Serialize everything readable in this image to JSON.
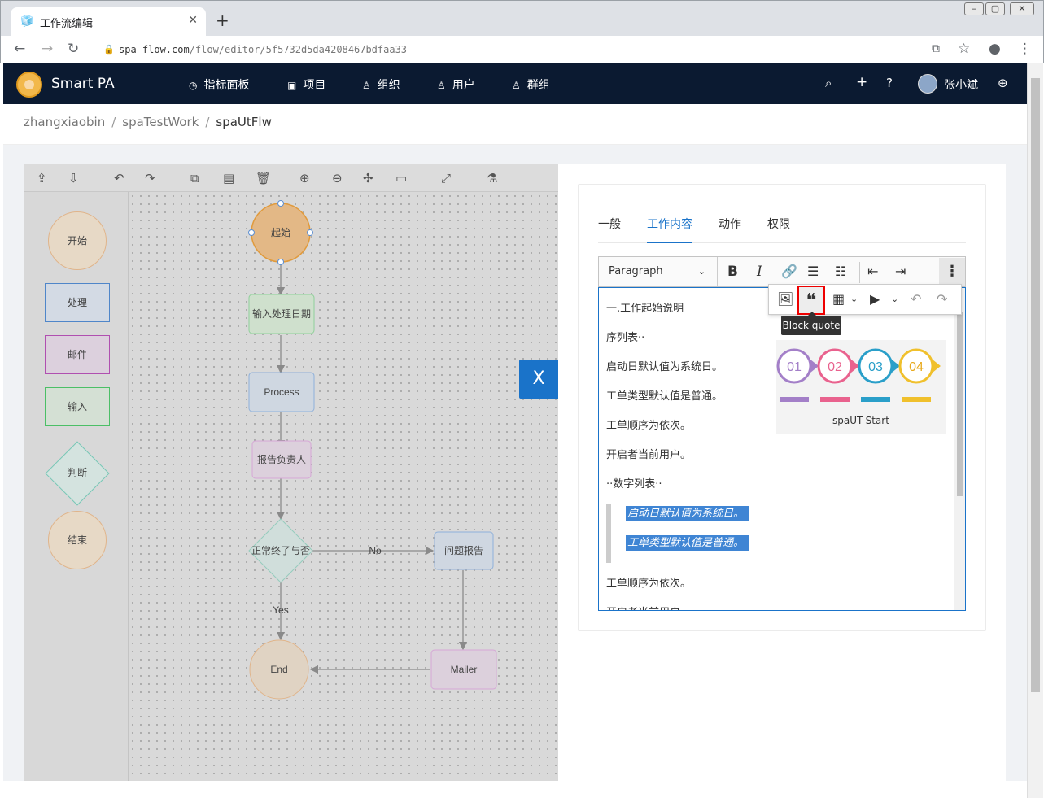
{
  "browser": {
    "tab_title": "工作流编辑",
    "tab_close": "✕",
    "new_tab": "+",
    "url_host": "spa-flow.com",
    "url_path": "/flow/editor/5f5732d5da4208467bdfaa33"
  },
  "app": {
    "name": "Smart PA",
    "nav": [
      {
        "label": "指标面板",
        "icon": "dashboard-icon"
      },
      {
        "label": "项目",
        "icon": "project-icon"
      },
      {
        "label": "组织",
        "icon": "org-icon"
      },
      {
        "label": "用户",
        "icon": "user-icon"
      },
      {
        "label": "群组",
        "icon": "group-icon"
      }
    ],
    "username": "张小斌"
  },
  "breadcrumb": [
    "zhangxiaobin",
    "spaTestWork",
    "spaUtFlw"
  ],
  "flow": {
    "palette": [
      "开始",
      "处理",
      "邮件",
      "输入",
      "判断",
      "结束"
    ],
    "nodes": {
      "start": "起始",
      "input": "输入处理日期",
      "process": "Process",
      "report": "报告负责人",
      "decision": "正常终了与否",
      "problem": "问题报告",
      "end": "End",
      "mailer": "Mailer",
      "edge_no": "No",
      "edge_yes": "Yes"
    }
  },
  "panel": {
    "close": "X",
    "tabs": [
      "一般",
      "工作内容",
      "动作",
      "权限"
    ],
    "active_tab": "工作内容",
    "toolbar": {
      "heading_select": "Paragraph"
    },
    "tooltip": "Block quote",
    "editor_lines": [
      "一.工作起始说明",
      "序列表··",
      "启动日默认值为系统日。",
      "工单类型默认值是普通。",
      "工单顺序为依次。",
      "开启者当前用户。",
      "··数字列表··"
    ],
    "quote_lines": [
      "启动日默认值为系统日。",
      "工单类型默认值是普通。"
    ],
    "after_lines": [
      "工单顺序为依次。",
      "开启者当前用户"
    ],
    "image_caption": "spaUT-Start",
    "image_steps": [
      "01",
      "02",
      "03",
      "04"
    ]
  }
}
